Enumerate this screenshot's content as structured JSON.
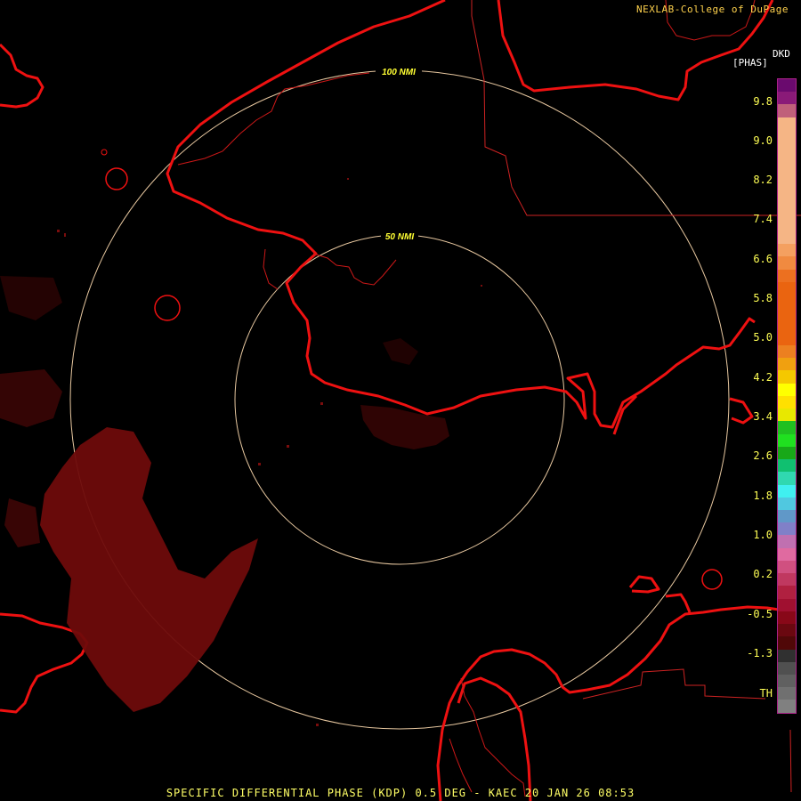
{
  "credit": "NEXLAB-College of DuPage",
  "legend": {
    "unit_top": "DKD",
    "unit_mid": "[PHAS]",
    "ticks": [
      "9.8",
      "9.0",
      "8.2",
      "7.4",
      "6.6",
      "5.8",
      "5.0",
      "4.2",
      "3.4",
      "2.6",
      "1.8",
      "1.0",
      "0.2",
      "-0.5",
      "-1.3",
      "TH"
    ],
    "colors": [
      "#6a0a6e",
      "#8a1a78",
      "#c0607a",
      "#f5b585",
      "#f5b585",
      "#f5b585",
      "#f5b585",
      "#f5b585",
      "#f5b585",
      "#f5b585",
      "#f5b585",
      "#f5b585",
      "#f5b585",
      "#f4a060",
      "#f08a40",
      "#ec7020",
      "#ea6410",
      "#ea6410",
      "#ea6410",
      "#ea6410",
      "#ea6410",
      "#ec8020",
      "#f0a010",
      "#f5c800",
      "#ffff00",
      "#ffe000",
      "#e8e800",
      "#20c020",
      "#20e020",
      "#18a818",
      "#10c070",
      "#30d8b0",
      "#40f0f0",
      "#50c8e0",
      "#6098c8",
      "#8080c8",
      "#c070b0",
      "#e06aa0",
      "#d05080",
      "#c03860",
      "#b02040",
      "#a01030",
      "#880818",
      "#6a0810",
      "#500808",
      "#303030",
      "#505050",
      "#606060",
      "#707070",
      "#808080"
    ]
  },
  "range_rings": [
    {
      "label": "100 NMI"
    },
    {
      "label": "50 NMI"
    }
  ],
  "footer": "SPECIFIC DIFFERENTIAL PHASE (KDP) 0.5 DEG - KAEC 20 JAN 26 08:53"
}
